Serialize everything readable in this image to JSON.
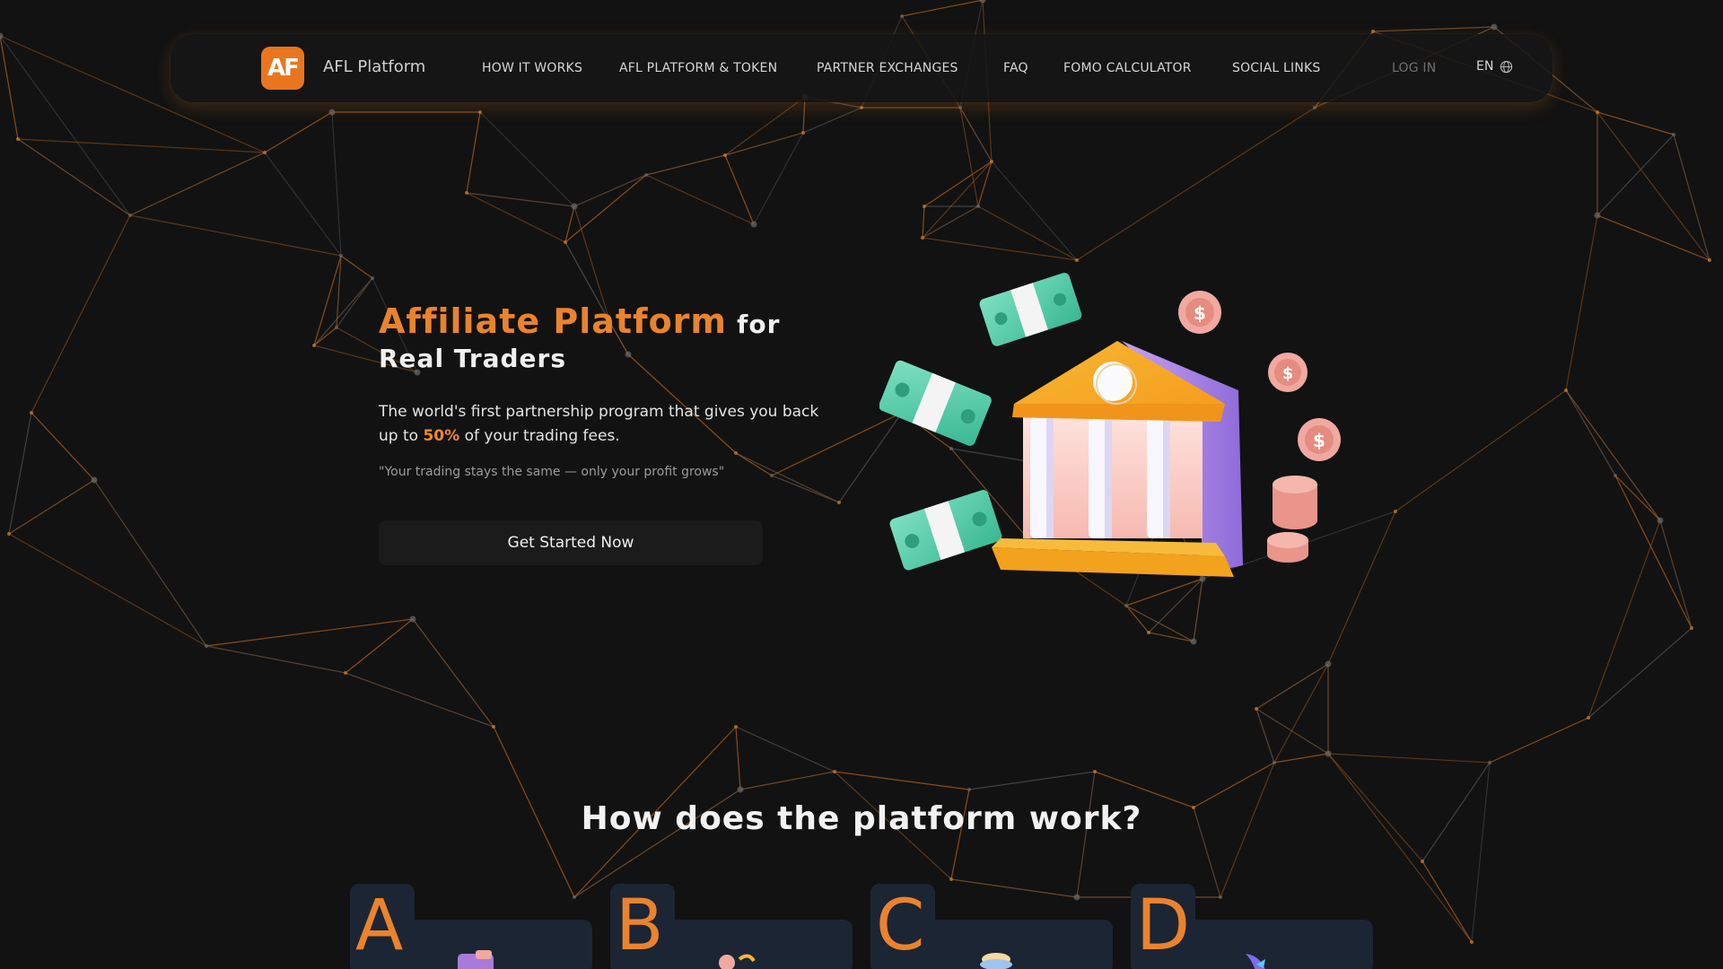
{
  "header": {
    "logo_text": "AF",
    "brand": "AFL Platform",
    "nav": [
      {
        "label": "HOW IT WORKS"
      },
      {
        "label": "AFL PLATFORM & TOKEN"
      },
      {
        "label": "PARTNER EXCHANGES"
      },
      {
        "label": "FAQ"
      },
      {
        "label": "FOMO CALCULATOR"
      },
      {
        "label": "SOCIAL LINKS"
      }
    ],
    "login": "LOG IN",
    "language": "EN",
    "language_icon": "globe-icon"
  },
  "hero": {
    "title_accent": "Affiliate Platform",
    "title_rest": "for Real Traders",
    "desc_before": "The world's first partnership program that gives you back up to",
    "desc_pct": "50%",
    "desc_after": "of your trading fees.",
    "quote": "\"Your trading stays the same — only your profit grows\"",
    "cta": "Get Started Now",
    "illustration": "bank-building-with-money-and-coins-icon"
  },
  "how": {
    "title": "How does the platform work?",
    "steps": [
      {
        "letter": "A",
        "icon": "wallet-icon"
      },
      {
        "letter": "B",
        "icon": "exchange-icon"
      },
      {
        "letter": "C",
        "icon": "coins-icon"
      },
      {
        "letter": "D",
        "icon": "rocket-icon"
      }
    ]
  },
  "colors": {
    "accent": "#e9832e",
    "background": "#121212",
    "card": "#1c2533"
  }
}
